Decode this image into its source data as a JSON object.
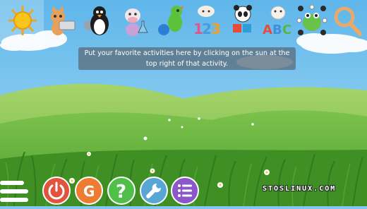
{
  "app": {
    "name": "GCompris"
  },
  "categories": [
    {
      "name": "favorites",
      "icon": "sun-icon",
      "selected": true
    },
    {
      "name": "computer",
      "icon": "cat-with-keyboard-icon"
    },
    {
      "name": "discovery",
      "icon": "penguin-gears-icon"
    },
    {
      "name": "experiment",
      "icon": "cow-flask-icon"
    },
    {
      "name": "fun",
      "icon": "dinosaur-ball-icon"
    },
    {
      "name": "math",
      "icon": "sheep-numbers-icon"
    },
    {
      "name": "puzzle",
      "icon": "panda-puzzle-icon"
    },
    {
      "name": "reading",
      "icon": "cow-letters-icon"
    },
    {
      "name": "strategy",
      "icon": "frog-board-icon"
    },
    {
      "name": "search",
      "icon": "magnifier-icon"
    }
  ],
  "tooltip": {
    "text": "Put your favorite activities here by clicking on the sun at the top right of that activity."
  },
  "bottom_bar": {
    "buttons": [
      {
        "name": "exit",
        "icon": "power-icon",
        "color": "#e0533f"
      },
      {
        "name": "about",
        "icon": "gcompris-g-icon",
        "color": "#ee7b32"
      },
      {
        "name": "help",
        "icon": "question-icon",
        "color": "#4fbf4a"
      },
      {
        "name": "settings",
        "icon": "wrench-icon",
        "color": "#58a6d6"
      },
      {
        "name": "menu",
        "icon": "list-icon",
        "color": "#8a58c8"
      }
    ]
  },
  "watermark": {
    "text": "STOSLINUX.COM"
  },
  "colors": {
    "sky": "#7fc8f0",
    "hill": "#8fcb5a",
    "grass": "#3f8f25"
  }
}
